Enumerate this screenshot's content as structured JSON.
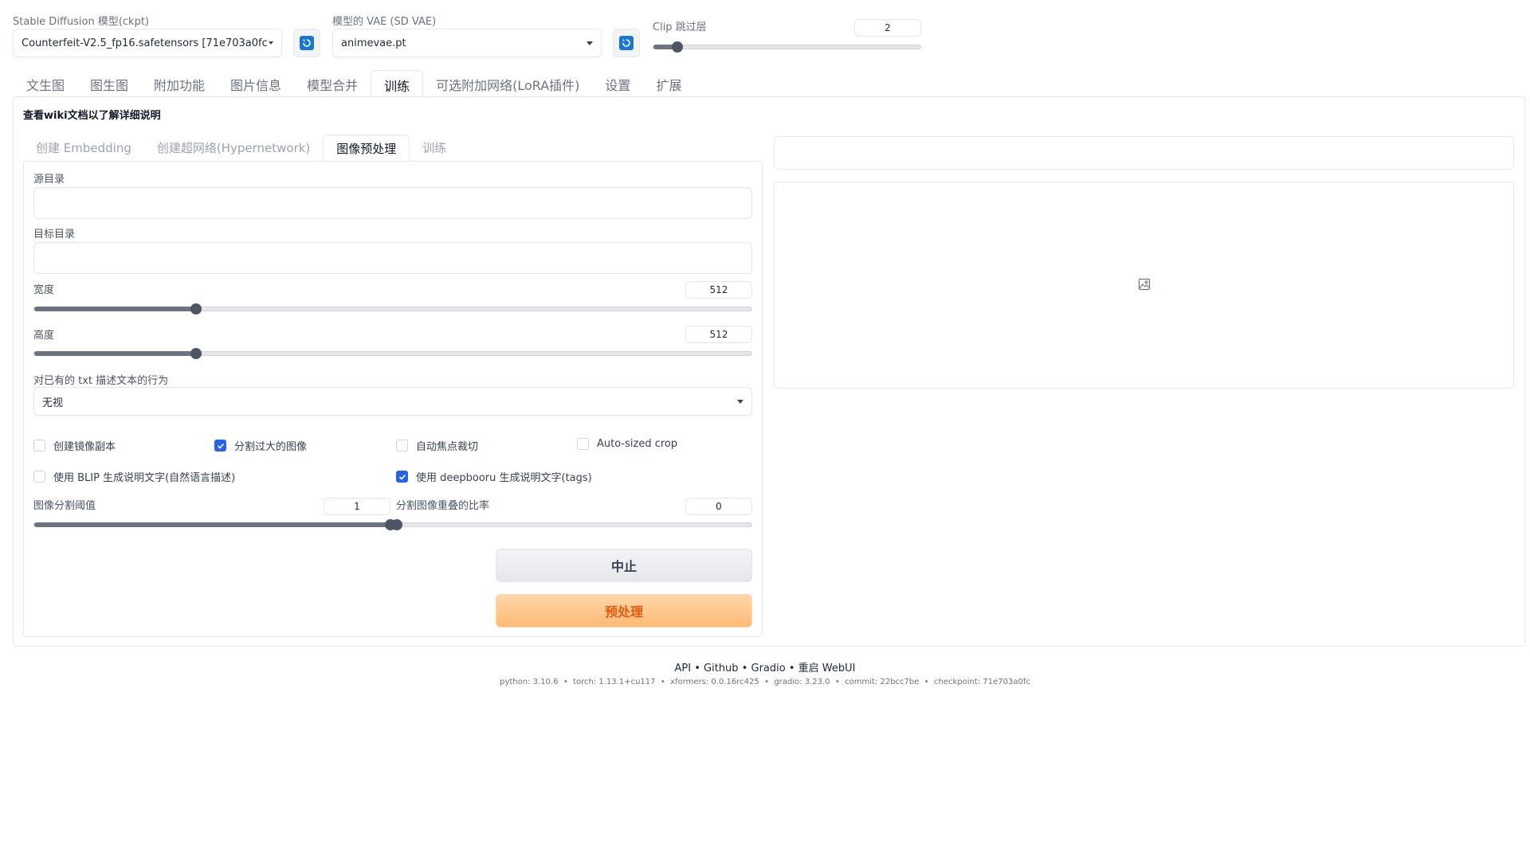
{
  "top": {
    "model_label": "Stable Diffusion 模型(ckpt)",
    "model_value": "Counterfeit-V2.5_fp16.safetensors [71e703a0fc]",
    "vae_label": "模型的 VAE (SD VAE)",
    "vae_value": "animevae.pt",
    "clip_label": "Clip 跳过层",
    "clip_value": "2",
    "clip_slider": {
      "min": 1,
      "max": 12,
      "value": 2
    }
  },
  "main_tabs": [
    "文生图",
    "图生图",
    "附加功能",
    "图片信息",
    "模型合并",
    "训练",
    "可选附加网络(LoRA插件)",
    "设置",
    "扩展"
  ],
  "active_main_tab": "训练",
  "train": {
    "wiki_note": "查看wiki文档以了解详细说明",
    "sub_tabs": [
      "创建 Embedding",
      "创建超网络(Hypernetwork)",
      "图像预处理",
      "训练"
    ],
    "active_sub_tab": "图像预处理",
    "source_dir_label": "源目录",
    "source_dir_value": "",
    "target_dir_label": "目标目录",
    "target_dir_value": "",
    "width_label": "宽度",
    "width_value": "512",
    "width_slider": {
      "min": 64,
      "max": 2048,
      "value": 512
    },
    "height_label": "高度",
    "height_value": "512",
    "height_slider": {
      "min": 64,
      "max": 2048,
      "value": 512
    },
    "txt_action_label": "对已有的 txt 描述文本的行为",
    "txt_action_value": "无视",
    "checkboxes": [
      {
        "label": "创建镜像副本",
        "checked": false
      },
      {
        "label": "分割过大的图像",
        "checked": true
      },
      {
        "label": "自动焦点裁切",
        "checked": false
      },
      {
        "label": "Auto-sized crop",
        "checked": false
      },
      {
        "label": "使用 BLIP 生成说明文字(自然语言描述)",
        "checked": false
      },
      {
        "label": "使用 deepbooru 生成说明文字(tags)",
        "checked": true
      }
    ],
    "split_threshold_label": "图像分割阈值",
    "split_threshold_value": "1",
    "split_threshold_slider": {
      "min": 0,
      "max": 1,
      "value": 1
    },
    "overlap_ratio_label": "分割图像重叠的比率",
    "overlap_ratio_value": "0",
    "overlap_ratio_slider": {
      "min": 0,
      "max": 0.9,
      "value": 0
    },
    "stop_button": "中止",
    "preprocess_button": "预处理"
  },
  "footer": {
    "links": [
      "API",
      "Github",
      "Gradio",
      "重启 WebUI"
    ],
    "separator": "•",
    "info": [
      "python: 3.10.6",
      "torch: 1.13.1+cu117",
      "xformers: 0.0.16rc425",
      "gradio: 3.23.0",
      "commit: 22bcc7be",
      "checkpoint: 71e703a0fc"
    ]
  },
  "colors": {
    "accent_blue": "#2563eb",
    "primary_orange": "#ea580c",
    "refresh_blue": "#1976d2"
  }
}
